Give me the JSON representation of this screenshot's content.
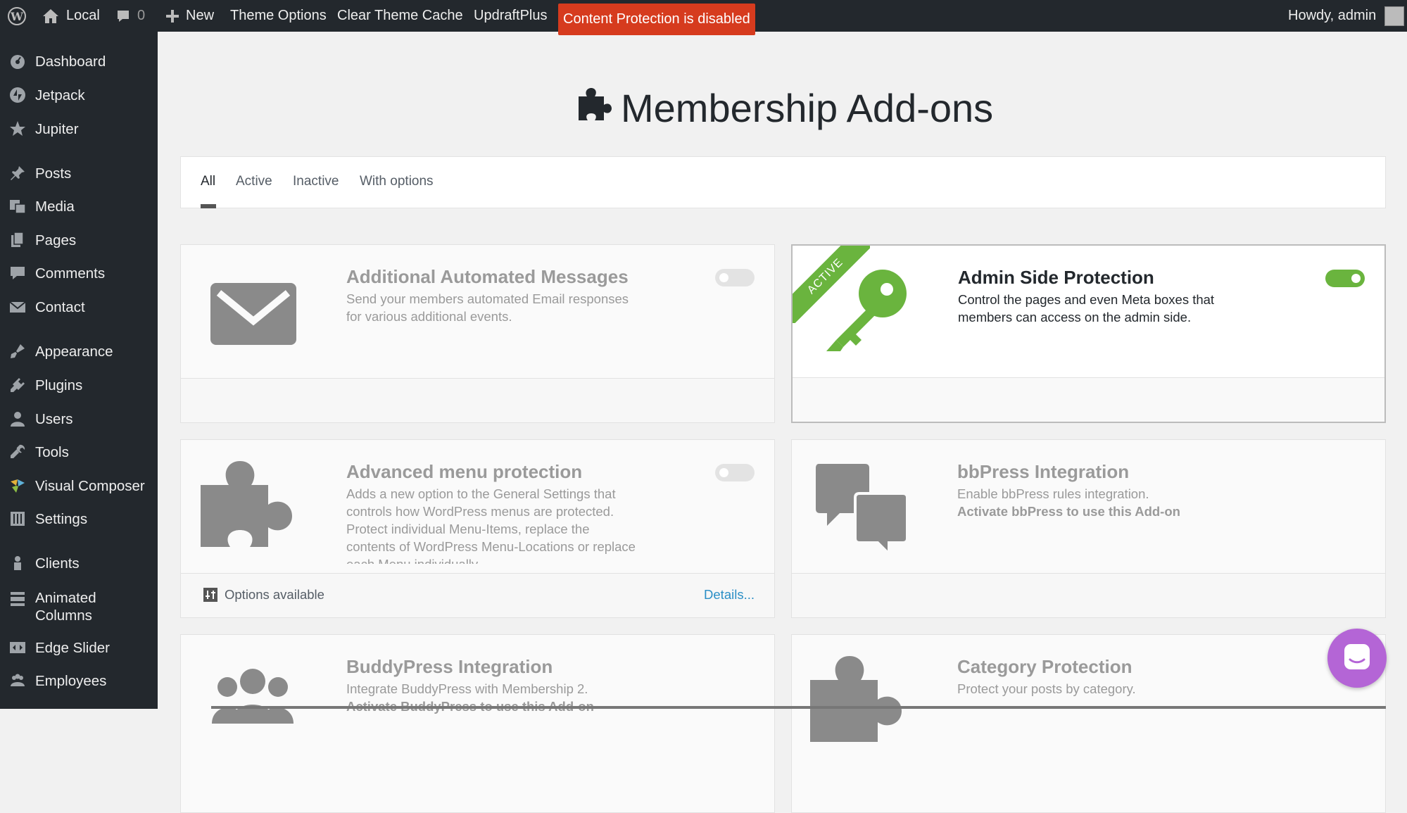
{
  "adminbar": {
    "site_name": "Local",
    "comments_count": "0",
    "new_label": "New",
    "theme_options": "Theme Options",
    "clear_cache": "Clear Theme Cache",
    "updraft": "UpdraftPlus",
    "content_protection": "Content Protection is disabled",
    "howdy": "Howdy, admin"
  },
  "sidebar": {
    "items": [
      {
        "label": "Dashboard",
        "icon": "dashboard-icon"
      },
      {
        "label": "Jetpack",
        "icon": "jetpack-icon"
      },
      {
        "label": "Jupiter",
        "icon": "star-icon"
      },
      {
        "label": "Posts",
        "icon": "pin-icon"
      },
      {
        "label": "Media",
        "icon": "media-icon"
      },
      {
        "label": "Pages",
        "icon": "pages-icon"
      },
      {
        "label": "Comments",
        "icon": "comment-icon"
      },
      {
        "label": "Contact",
        "icon": "mail-icon"
      },
      {
        "label": "Appearance",
        "icon": "brush-icon"
      },
      {
        "label": "Plugins",
        "icon": "plug-icon"
      },
      {
        "label": "Users",
        "icon": "user-icon"
      },
      {
        "label": "Tools",
        "icon": "wrench-icon"
      },
      {
        "label": "Visual Composer",
        "icon": "visual-composer-icon"
      },
      {
        "label": "Settings",
        "icon": "settings-icon"
      },
      {
        "label": "Clients",
        "icon": "clients-icon"
      },
      {
        "label": "Animated Columns",
        "icon": "columns-icon"
      },
      {
        "label": "Edge Slider",
        "icon": "slider-icon"
      },
      {
        "label": "Employees",
        "icon": "employees-icon"
      }
    ]
  },
  "page": {
    "title": "Membership Add-ons"
  },
  "tabs": [
    "All",
    "Active",
    "Inactive",
    "With options"
  ],
  "addons": [
    {
      "title": "Additional Automated Messages",
      "desc": "Send your members automated Email responses for various additional events.",
      "active": false
    },
    {
      "title": "Admin Side Protection",
      "desc": "Control the pages and even Meta boxes that members can access on the admin side.",
      "active": true,
      "ribbon": "ACTIVE"
    },
    {
      "title": "Advanced menu protection",
      "desc": "Adds a new option to the General Settings that controls how WordPress menus are protected. Protect individual Menu-Items, replace the contents of WordPress Menu-Locations or replace each Menu individually.",
      "active": false,
      "options_label": "Options available",
      "details_label": "Details..."
    },
    {
      "title": "bbPress Integration",
      "desc": "Enable bbPress rules integration.",
      "requirement": "Activate bbPress to use this Add-on"
    },
    {
      "title": "BuddyPress Integration",
      "desc": "Integrate BuddyPress with Membership 2.",
      "requirement": "Activate BuddyPress to use this Add-on"
    },
    {
      "title": "Category Protection",
      "desc": "Protect your posts by category."
    }
  ],
  "colors": {
    "adminbar_bg": "#23282d",
    "badge_red": "#d63b1e",
    "active_green": "#6ab43e",
    "link_blue": "#2b8fc6",
    "chat_purple": "#b465d6"
  }
}
